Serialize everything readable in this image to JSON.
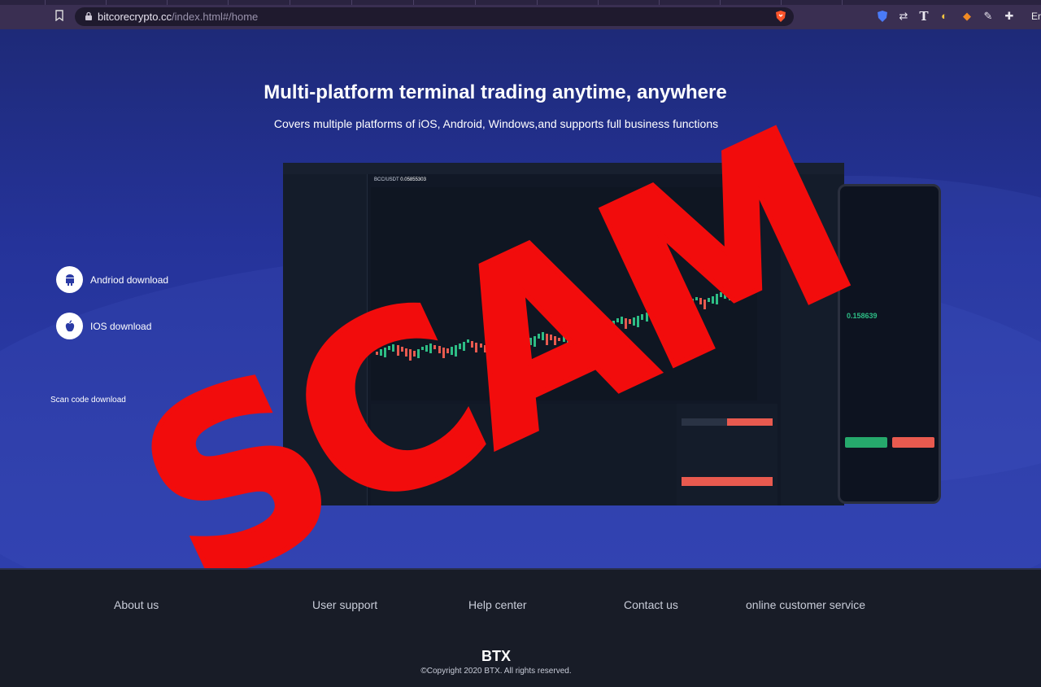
{
  "browser": {
    "url_host": "bitcorecrypto.cc",
    "url_path": "/index.html#/home",
    "lang_text": "En"
  },
  "hero": {
    "title": "Multi-platform terminal trading anytime, anywhere",
    "subtitle": "Covers multiple platforms of iOS, Android, Windows,and supports full business functions",
    "android_label": "Andriod download",
    "ios_label": "IOS download",
    "scan_label": "Scan code download"
  },
  "terminal": {
    "pair": "BCC/USDT",
    "price": "0.05855303",
    "phone_price": "0.158639"
  },
  "overlay": {
    "stamp_text": "SCAM",
    "color": "#f20c0c"
  },
  "footer": {
    "links": [
      "About us",
      "User support",
      "Help center",
      "Contact us",
      "online customer service"
    ],
    "brand": "BTX",
    "copyright": "©Copyright 2020 BTX. All rights reserved."
  },
  "colors": {
    "hero_bg": "#25339a",
    "footer_bg": "#181c27",
    "buy": "#26a96c",
    "sell": "#e85a4f"
  }
}
